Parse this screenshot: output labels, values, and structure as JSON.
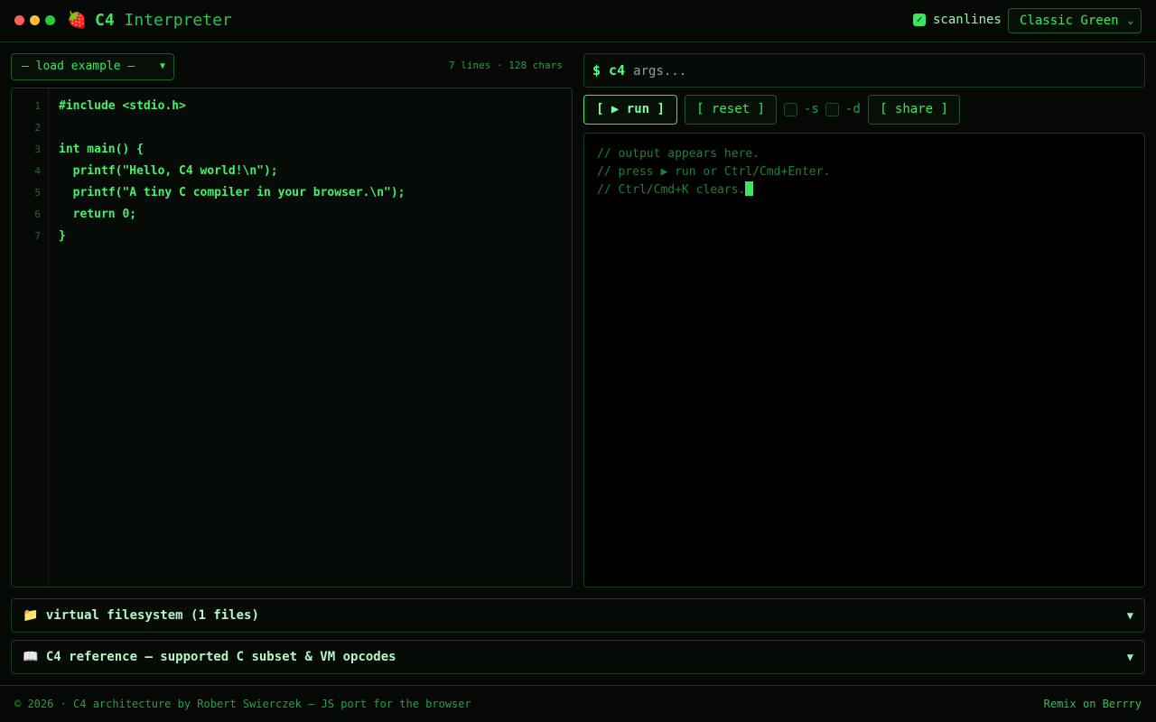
{
  "app": {
    "logo_icon": "strawberry-icon",
    "logo_glyph": "🍓",
    "title_bold": "C4",
    "title_rest": "Interpreter"
  },
  "header": {
    "scanlines_label": "scanlines",
    "scanlines_checked": true,
    "theme_selected": "Classic Green"
  },
  "editor": {
    "example_select": "— load example —",
    "stats": "7 lines · 128 chars",
    "lines": [
      "#include <stdio.h>",
      "",
      "int main() {",
      "  printf(\"Hello, C4 world!\\n\");",
      "  printf(\"A tiny C compiler in your browser.\\n\");",
      "  return 0;",
      "}"
    ],
    "line_numbers": [
      "1",
      "2",
      "3",
      "4",
      "5",
      "6",
      "7"
    ]
  },
  "terminal": {
    "prompt": "$ c4",
    "args_placeholder": "args...",
    "run_label": "[ ▶ run ]",
    "reset_label": "[ reset ]",
    "flag_s": "-s",
    "flag_d": "-d",
    "share_label": "[ share ]",
    "output_lines": [
      "// output appears here.",
      "// press ▶ run or Ctrl/Cmd+Enter.",
      "// Ctrl/Cmd+K clears."
    ]
  },
  "panels": {
    "filesystem_icon": "📁",
    "filesystem_label": "virtual filesystem (1 files)",
    "reference_icon": "📖",
    "reference_label": "C4 reference — supported C subset & VM opcodes",
    "caret": "▼"
  },
  "footer": {
    "left": "© 2026 · C4 architecture by Robert Swierczek — JS port for the browser",
    "right": "Remix on Berrry"
  },
  "colors": {
    "accent": "#39e75f",
    "background": "#050805",
    "border": "#153d1d"
  }
}
